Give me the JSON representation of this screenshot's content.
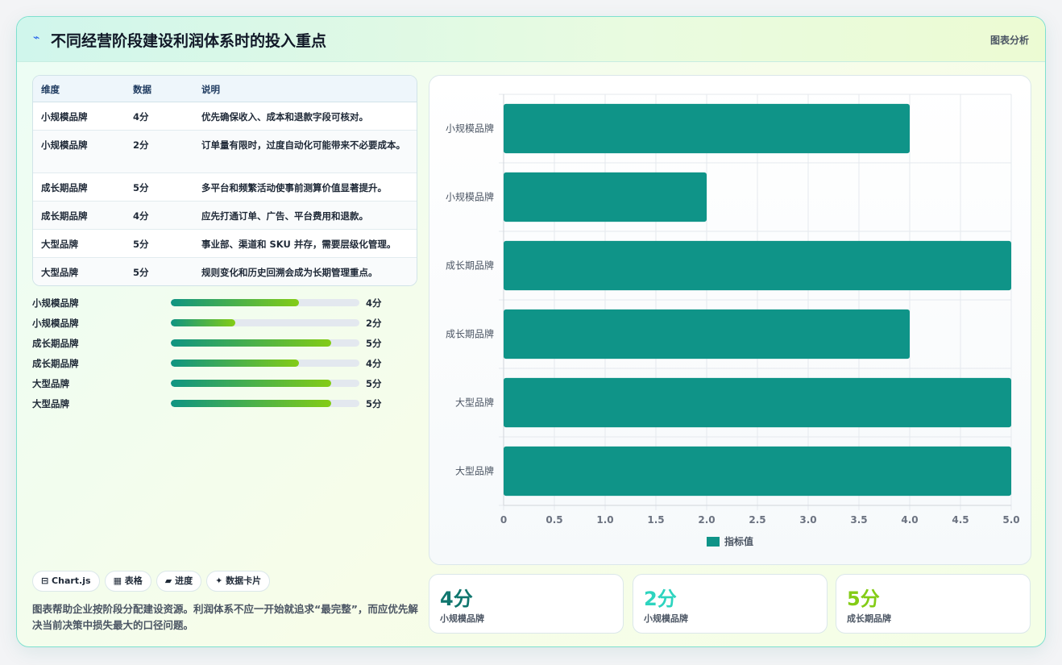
{
  "header": {
    "icon": "sparkle-icon",
    "title": "不同经营阶段建设利润体系时的投入重点",
    "tag": "图表分析"
  },
  "table": {
    "columns": [
      "维度",
      "数据",
      "说明"
    ],
    "rows": [
      [
        "小规模品牌",
        "4分",
        "优先确保收入、成本和退款字段可核对。"
      ],
      [
        "小规模品牌",
        "2分",
        "订单量有限时，过度自动化可能带来不必要成本。"
      ],
      [
        "成长期品牌",
        "5分",
        "多平台和频繁活动使事前测算价值显著提升。"
      ],
      [
        "成长期品牌",
        "4分",
        "应先打通订单、广告、平台费用和退款。"
      ],
      [
        "大型品牌",
        "5分",
        "事业部、渠道和 SKU 并存，需要层级化管理。"
      ],
      [
        "大型品牌",
        "5分",
        "规则变化和历史回溯会成为长期管理重点。"
      ]
    ]
  },
  "progress": [
    {
      "label": "小规模品牌",
      "value": 4,
      "max": 5,
      "display": "4分"
    },
    {
      "label": "小规模品牌",
      "value": 2,
      "max": 5,
      "display": "2分"
    },
    {
      "label": "成长期品牌",
      "value": 5,
      "max": 5,
      "display": "5分"
    },
    {
      "label": "成长期品牌",
      "value": 4,
      "max": 5,
      "display": "4分"
    },
    {
      "label": "大型品牌",
      "value": 5,
      "max": 5,
      "display": "5分"
    },
    {
      "label": "大型品牌",
      "value": 5,
      "max": 5,
      "display": "5分"
    }
  ],
  "chips": [
    "⊟ Chart.js",
    "▦ 表格",
    "▰ 进度",
    "✦ 数据卡片"
  ],
  "note": "图表帮助企业按阶段分配建设资源。利润体系不应一开始就追求“最完整”，而应优先解决当前决策中损失最大的口径问题。",
  "chart_data": {
    "type": "bar",
    "orientation": "horizontal",
    "categories": [
      "小规模品牌",
      "小规模品牌",
      "成长期品牌",
      "成长期品牌",
      "大型品牌",
      "大型品牌"
    ],
    "series": [
      {
        "name": "指标值",
        "values": [
          4,
          2,
          5,
          4,
          5,
          5
        ],
        "color": "#0f9488"
      }
    ],
    "xlim": [
      0,
      5
    ],
    "xticks": [
      "0",
      "0.5",
      "1.0",
      "1.5",
      "2.0",
      "2.5",
      "3.0",
      "3.5",
      "4.0",
      "4.5",
      "5.0"
    ],
    "grid": true,
    "legend": "bottom"
  },
  "kpis": [
    {
      "value": "4分",
      "label": "小规模品牌",
      "color": "#0f766e"
    },
    {
      "value": "2分",
      "label": "小规模品牌",
      "color": "#2dd4bf"
    },
    {
      "value": "5分",
      "label": "成长期品牌",
      "color": "#84cc16"
    }
  ]
}
